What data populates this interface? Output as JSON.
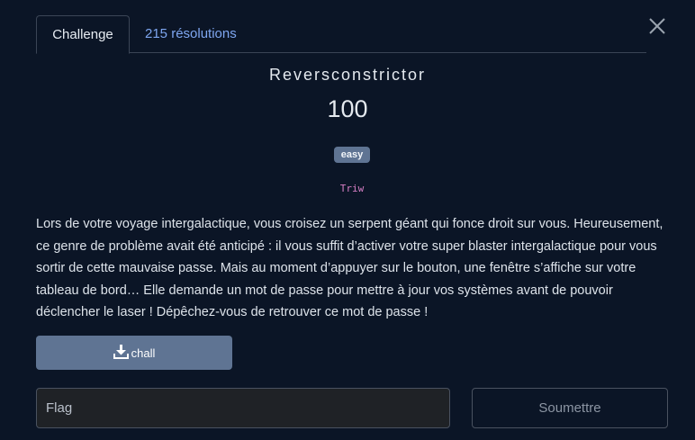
{
  "tabs": {
    "challenge": "Challenge",
    "solves": "215 résolutions"
  },
  "challenge": {
    "name": "Reversconstrictor",
    "points": "100",
    "difficulty": "easy",
    "author": "Triw",
    "description": "Lors de votre voyage intergalactique, vous croisez un serpent géant qui fonce droit sur vous. Heureusement, ce genre de problème avait été anticipé : il vous suffit d’activer votre super blaster intergalactique pour vous sortir de cette mauvaise passe. Mais au moment d’appuyer sur le bouton, une fenêtre s’affiche sur votre tableau de bord… Elle demande un mot de passe pour mettre à jour vos systèmes avant de pouvoir déclencher le laser ! Dépêchez-vous de retrouver ce mot de passe !"
  },
  "download": {
    "label": "chall",
    "icon": "download-icon"
  },
  "form": {
    "flag_placeholder": "Flag",
    "flag_value": "",
    "submit_label": "Soumettre"
  },
  "icons": {
    "close": "close-icon"
  },
  "colors": {
    "background": "#0b1526",
    "accent_link": "#7ea6f0",
    "button": "#5f7493",
    "author": "#d77fc5"
  }
}
